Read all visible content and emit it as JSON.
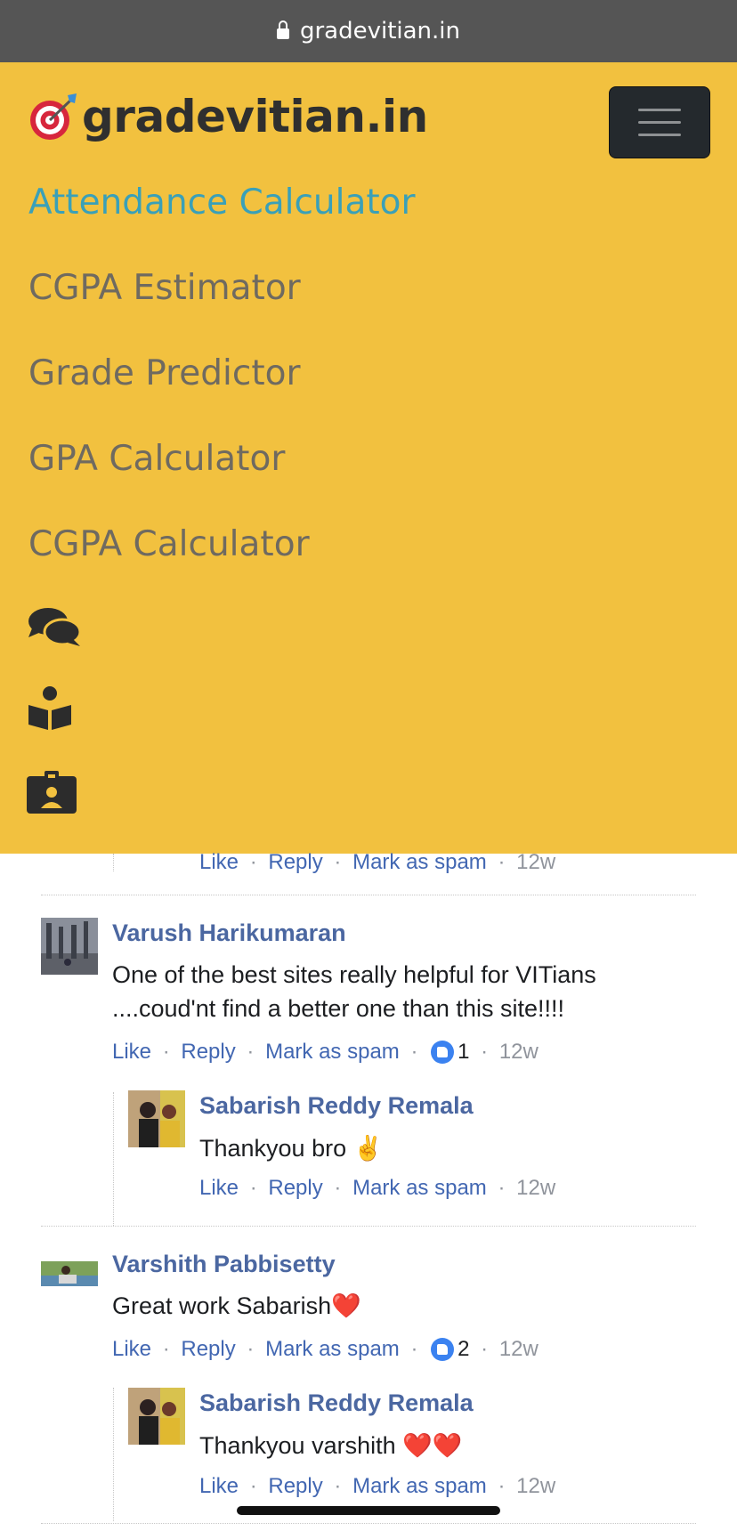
{
  "browser": {
    "url": "gradevitian.in"
  },
  "navbar": {
    "brand": "gradevitian.in",
    "brand_icon": "dart-target-icon",
    "toggle_icon": "hamburger-icon",
    "items": [
      {
        "label": "Attendance Calculator",
        "active": true
      },
      {
        "label": "CGPA Estimator",
        "active": false
      },
      {
        "label": "Grade Predictor",
        "active": false
      },
      {
        "label": "GPA Calculator",
        "active": false
      },
      {
        "label": "CGPA Calculator",
        "active": false
      }
    ],
    "icons": [
      "comments-icon",
      "book-reader-icon",
      "id-badge-icon"
    ],
    "colors": {
      "background": "#f2c13f",
      "active": "#3aa0b8",
      "inactive": "#6f6a60"
    }
  },
  "comments": {
    "actions": {
      "like": "Like",
      "reply": "Reply",
      "spam": "Mark as spam",
      "sep": "·"
    },
    "top_partial": {
      "time": "12w"
    },
    "threads": [
      {
        "author": "Varush Harikumaran",
        "text": "One of the best sites really helpful for VITians ....coud'nt find a better one than this site!!!!",
        "likes": "1",
        "time": "12w",
        "reply": {
          "author": "Sabarish Reddy Remala",
          "text": "Thankyou bro ✌",
          "time": "12w"
        }
      },
      {
        "author": "Varshith Pabbisetty",
        "text": "Great work Sabarish❤️",
        "likes": "2",
        "time": "12w",
        "reply": {
          "author": "Sabarish Reddy Remala",
          "text": "Thankyou varshith ❤️❤️",
          "time": "12w"
        }
      }
    ]
  }
}
